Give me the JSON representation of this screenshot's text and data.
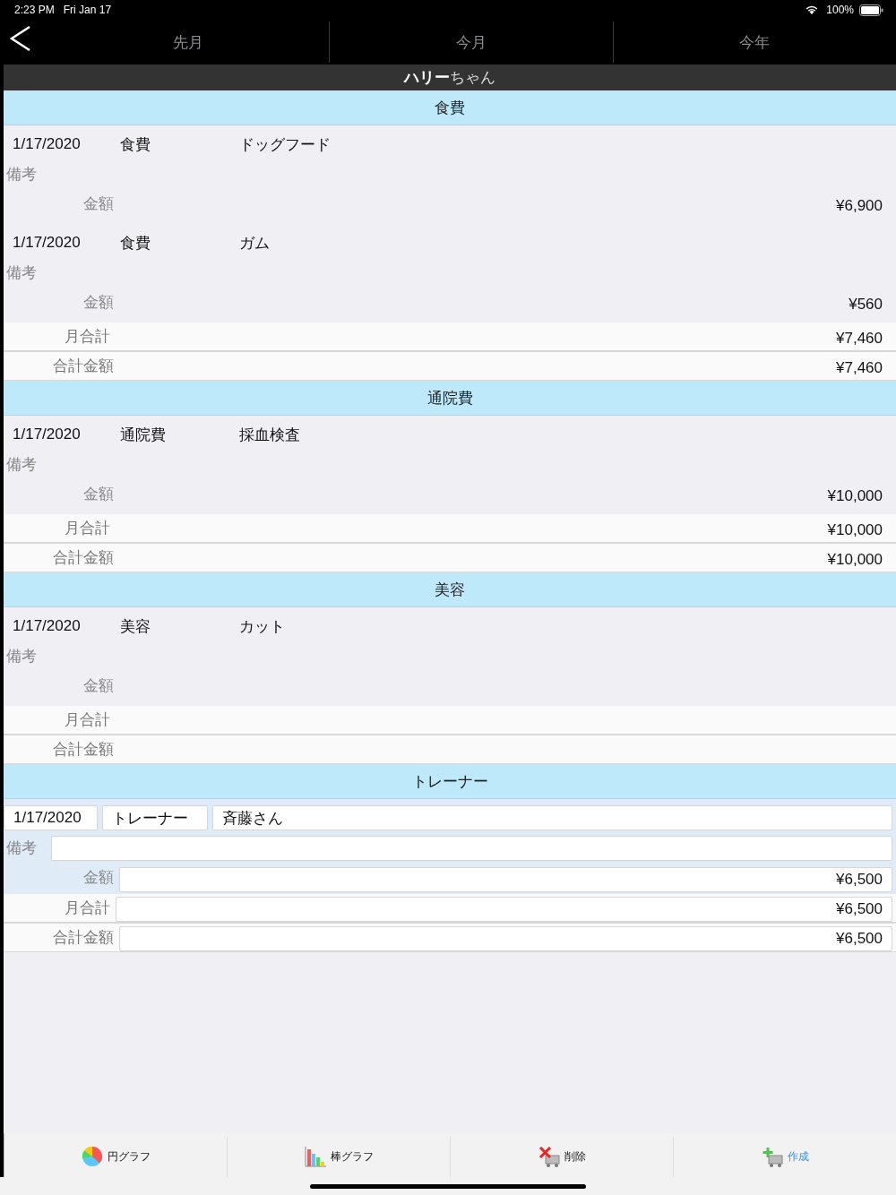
{
  "status_bar": {
    "time": "2:23 PM",
    "date": "Fri Jan 17",
    "battery": "100%"
  },
  "nav": {
    "tabs": [
      {
        "label": "先月",
        "selected": false
      },
      {
        "label": "今月",
        "selected": false
      },
      {
        "label": "今年",
        "selected": false
      }
    ]
  },
  "title": "**ハリー**ちゃん",
  "sections": [
    {
      "title": "食費",
      "entries": [
        {
          "date": "1/17/2020",
          "category": "食費",
          "item": "ドッグフード",
          "memo_label": "備考",
          "amount_label": "金額",
          "amount": "¥6,900",
          "selected": false
        },
        {
          "date": "1/17/2020",
          "category": "食費",
          "item": "ガム",
          "memo_label": "備考",
          "amount_label": "金額",
          "amount": "¥560",
          "selected": false
        }
      ],
      "month_total_label": "月合計",
      "month_total": "¥7,460",
      "grand_total_label": "合計金額",
      "grand_total": "¥7,460"
    },
    {
      "title": "通院費",
      "entries": [
        {
          "date": "1/17/2020",
          "category": "通院費",
          "item": "採血検査",
          "memo_label": "備考",
          "amount_label": "金額",
          "amount": "¥10,000",
          "selected": false
        }
      ],
      "month_total_label": "月合計",
      "month_total": "¥10,000",
      "grand_total_label": "合計金額",
      "grand_total": "¥10,000"
    },
    {
      "title": "美容",
      "entries": [
        {
          "date": "1/17/2020",
          "category": "美容",
          "item": "カット",
          "memo_label": "備考",
          "amount_label": "金額",
          "selected": false
        }
      ],
      "month_total_label": "月合計",
      "grand_total_label": "合計金額"
    },
    {
      "title": "トレーナー",
      "entries": [
        {
          "date": "1/17/2020",
          "category": "トレーナー",
          "item": "斉藤さん",
          "memo_label": "備考",
          "amount_label": "金額",
          "amount": "¥6,500",
          "selected": true
        }
      ],
      "month_total_label": "月合計",
      "month_total": "¥6,500",
      "grand_total_label": "合計金額",
      "grand_total": "¥6,500"
    }
  ],
  "toolbar": [
    {
      "kind": "pie",
      "label": "円グラフ"
    },
    {
      "kind": "bar",
      "label": "棒グラフ"
    },
    {
      "kind": "delete",
      "label": "削除"
    },
    {
      "kind": "create",
      "label": "作成"
    }
  ]
}
